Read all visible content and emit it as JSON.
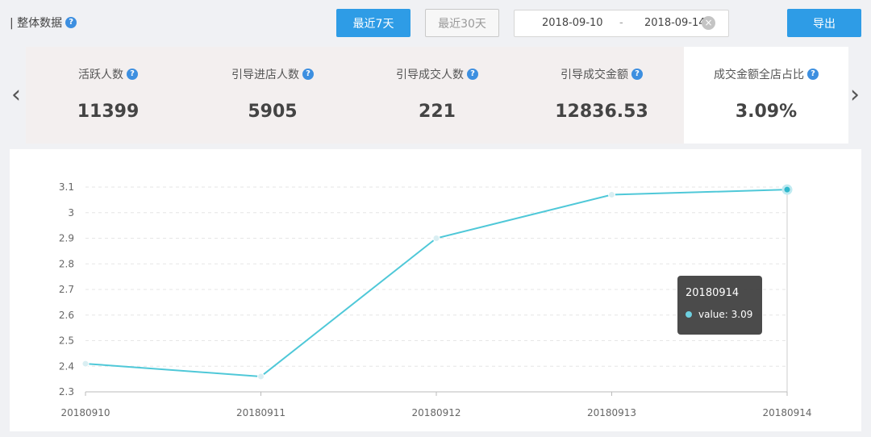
{
  "header": {
    "title": "| 整体数据",
    "btn_7days": "最近7天",
    "btn_30days": "最近30天",
    "date_start": "2018-09-10",
    "date_sep": "-",
    "date_end": "2018-09-14",
    "export_label": "导出"
  },
  "stats": [
    {
      "label": "活跃人数",
      "value": "11399"
    },
    {
      "label": "引导进店人数",
      "value": "5905"
    },
    {
      "label": "引导成交人数",
      "value": "221"
    },
    {
      "label": "引导成交金额",
      "value": "12836.53"
    },
    {
      "label": "成交金额全店占比",
      "value": "3.09%"
    }
  ],
  "icons": {
    "help": "help-icon",
    "prev": "chevron-left-icon",
    "next": "chevron-right-icon",
    "clear": "clear-icon"
  },
  "colors": {
    "primary": "#2e9ce6",
    "line": "#4fc8d8",
    "help": "#3d8fe0"
  },
  "tooltip": {
    "title": "20180914",
    "row": "value: 3.09"
  },
  "chart_data": {
    "type": "line",
    "x": [
      "20180910",
      "20180911",
      "20180912",
      "20180913",
      "20180914"
    ],
    "series": [
      {
        "values": [
          2.41,
          2.36,
          2.9,
          3.07,
          3.09
        ]
      }
    ],
    "yticks": [
      "2.3",
      "2.4",
      "2.5",
      "2.6",
      "2.7",
      "2.8",
      "2.9",
      "3",
      "3.1"
    ],
    "ylim": [
      2.3,
      3.1
    ],
    "grid": true,
    "title": "",
    "xlabel": "",
    "ylabel": ""
  }
}
